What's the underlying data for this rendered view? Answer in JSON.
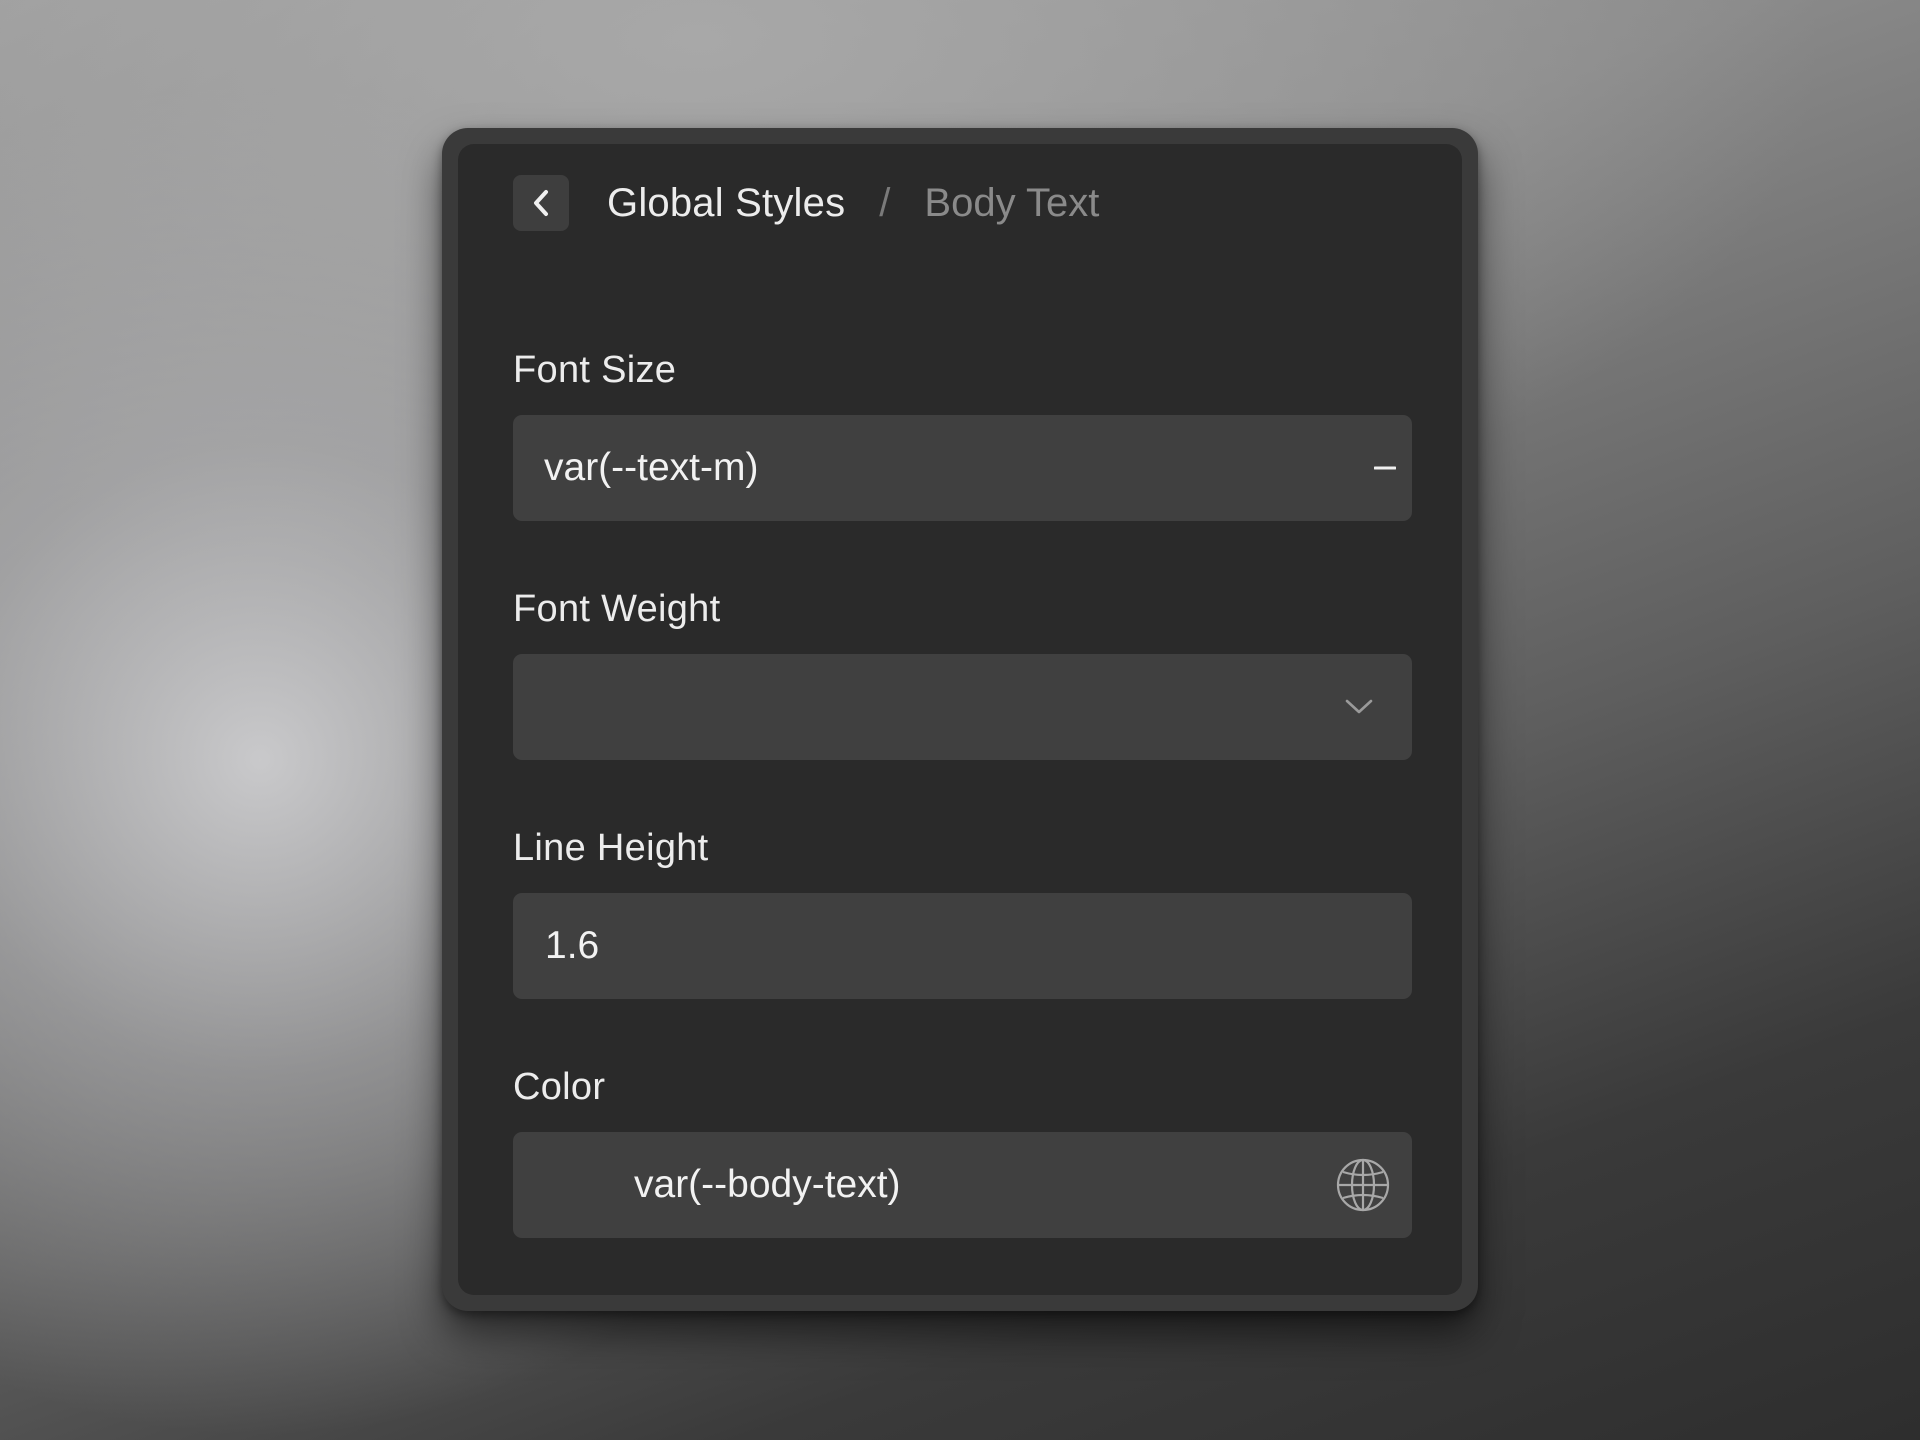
{
  "breadcrumb": {
    "back_icon": "chevron-left-icon",
    "current": "Global Styles",
    "separator": "/",
    "child": "Body Text"
  },
  "fields": {
    "font_size": {
      "label": "Font Size",
      "value": "var(--text-m)",
      "trailing_icon": "minus-icon"
    },
    "font_weight": {
      "label": "Font Weight",
      "value": "",
      "trailing_icon": "chevron-down-icon"
    },
    "line_height": {
      "label": "Line Height",
      "value": "1.6"
    },
    "color": {
      "label": "Color",
      "value": "var(--body-text)",
      "trailing_icon": "globe-icon"
    }
  },
  "colors": {
    "panel_bg": "#2a2a2a",
    "field_bg": "#404040",
    "text_primary": "#ececec",
    "text_muted": "#8a8a8a"
  }
}
